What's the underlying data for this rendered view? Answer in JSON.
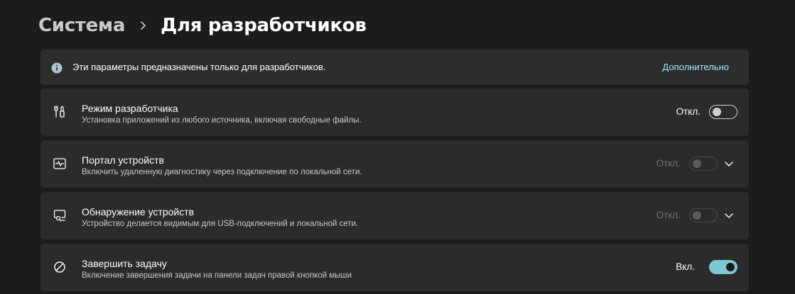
{
  "breadcrumb": {
    "parent": "Система",
    "current": "Для разработчиков"
  },
  "info": {
    "icon": "info-icon",
    "text": "Эти параметры предназначены только для разработчиков.",
    "link": "Дополнительно"
  },
  "settings": [
    {
      "icon": "developer-tools-icon",
      "title": "Режим разработчика",
      "description": "Установка приложений из любого источника, включая свободные файлы.",
      "state": "Откл.",
      "enabled": true,
      "on": false,
      "expandable": false
    },
    {
      "icon": "device-portal-icon",
      "title": "Портал устройств",
      "description": "Включить удаленную диагностику через подключение по локальной сети.",
      "state": "Откл.",
      "enabled": false,
      "on": false,
      "expandable": true
    },
    {
      "icon": "device-discovery-icon",
      "title": "Обнаружение устройств",
      "description": "Устройство делается видимым для USB-подключений и локальной сети.",
      "state": "Откл.",
      "enabled": false,
      "on": false,
      "expandable": true
    },
    {
      "icon": "end-task-icon",
      "title": "Завершить задачу",
      "description": "Включение завершения задачи на панели задач правой кнопкой мыши",
      "state": "Вкл.",
      "enabled": true,
      "on": true,
      "expandable": false
    }
  ],
  "colors": {
    "background": "#1c1c1c",
    "card": "#2b2b2b",
    "accent": "#7fc6d3",
    "link": "#99ebff"
  }
}
